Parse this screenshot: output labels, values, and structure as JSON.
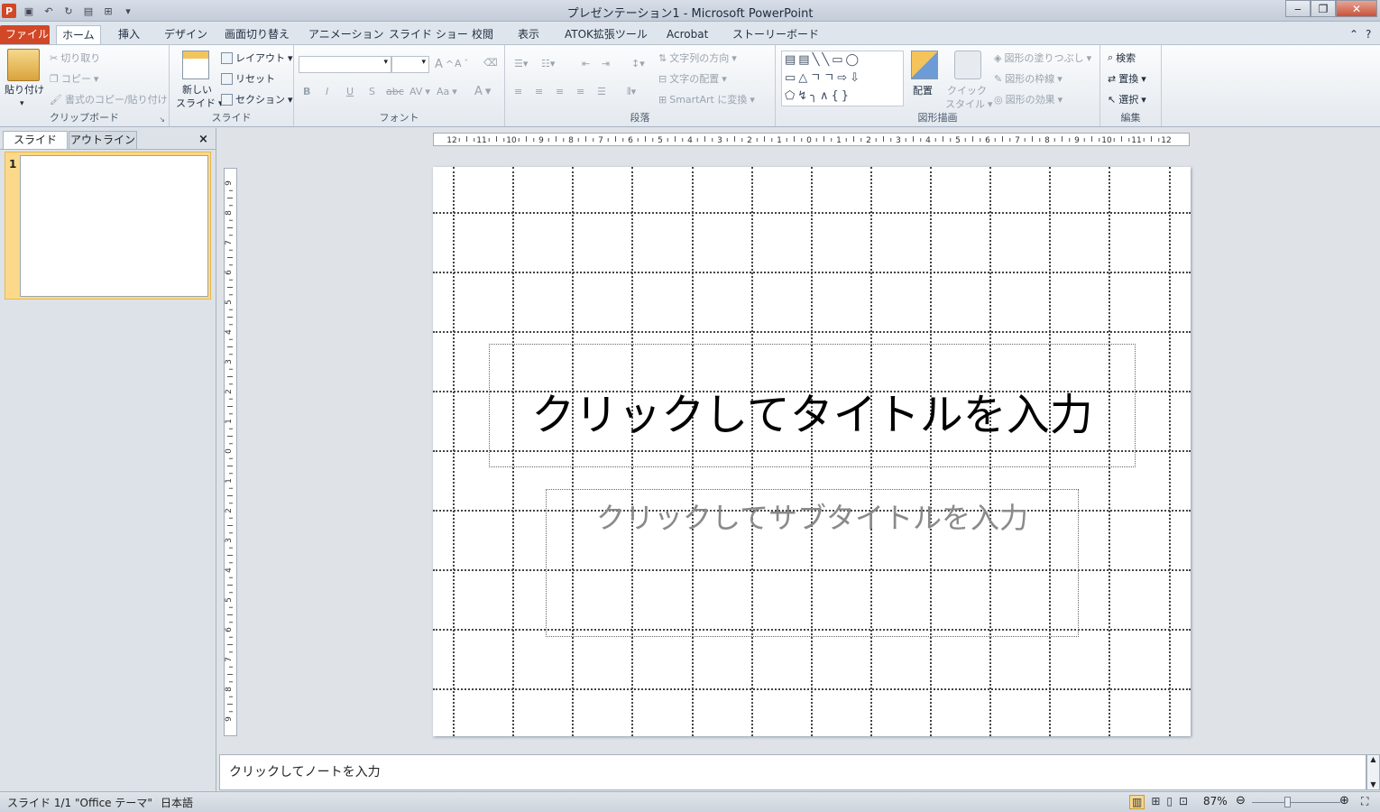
{
  "window": {
    "title": "プレゼンテーション1 - Microsoft PowerPoint",
    "minimize": "‒",
    "restore": "❐",
    "close": "✕",
    "logo": "P"
  },
  "qat": {
    "icons": [
      "save-icon",
      "undo-icon",
      "redo-icon",
      "format-icon",
      "insert-icon",
      "customize-icon"
    ]
  },
  "tabs": {
    "file": "ファイル",
    "items": [
      "ホーム",
      "挿入",
      "デザイン",
      "画面切り替え",
      "アニメーション",
      "スライド ショー",
      "校閲",
      "表示",
      "ATOK拡張ツール",
      "Acrobat",
      "ストーリーボード"
    ]
  },
  "ribbon": {
    "clipboard": {
      "label": "クリップボード",
      "paste": "貼り付け",
      "cut": "切り取り",
      "copy": "コピー",
      "format_painter": "書式のコピー/貼り付け"
    },
    "slides": {
      "label": "スライド",
      "new_slide_1": "新しい",
      "new_slide_2": "スライド",
      "layout": "レイアウト",
      "reset": "リセット",
      "section": "セクション"
    },
    "font": {
      "label": "フォント",
      "bold": "B",
      "italic": "I",
      "underline": "U",
      "shadow": "S",
      "strike": "abc",
      "spacing": "AV",
      "case": "Aa",
      "color": "A"
    },
    "paragraph": {
      "label": "段落",
      "text_direction": "文字列の方向",
      "align_text": "文字の配置",
      "smartart": "SmartArt に変換"
    },
    "drawing": {
      "label": "図形描画",
      "arrange": "配置",
      "quick_style_1": "クイック",
      "quick_style_2": "スタイル",
      "fill": "図形の塗りつぶし",
      "outline": "図形の枠線",
      "effects": "図形の効果"
    },
    "editing": {
      "label": "編集",
      "find": "検索",
      "replace": "置換",
      "select": "選択"
    }
  },
  "left_panel": {
    "tab_slides": "スライド",
    "tab_outline": "アウトライン",
    "close": "×",
    "slide_number": "1"
  },
  "slide": {
    "title_placeholder": "クリックしてタイトルを入力",
    "subtitle_placeholder": "クリックしてサブタイトルを入力"
  },
  "notes": {
    "placeholder": "クリックしてノートを入力"
  },
  "status": {
    "slide": "スライド 1/1",
    "theme": "\"Office テーマ\"",
    "language": "日本語",
    "zoom": "87%"
  },
  "hruler": {
    "labels": [
      "12",
      "11",
      "10",
      "9",
      "8",
      "7",
      "6",
      "5",
      "4",
      "3",
      "2",
      "1",
      "0",
      "1",
      "2",
      "3",
      "4",
      "5",
      "6",
      "7",
      "8",
      "9",
      "10",
      "11",
      "12"
    ]
  },
  "vruler": {
    "labels": [
      "9",
      "8",
      "7",
      "6",
      "5",
      "4",
      "3",
      "2",
      "1",
      "0",
      "1",
      "2",
      "3",
      "4",
      "5",
      "6",
      "7",
      "8",
      "9"
    ]
  }
}
